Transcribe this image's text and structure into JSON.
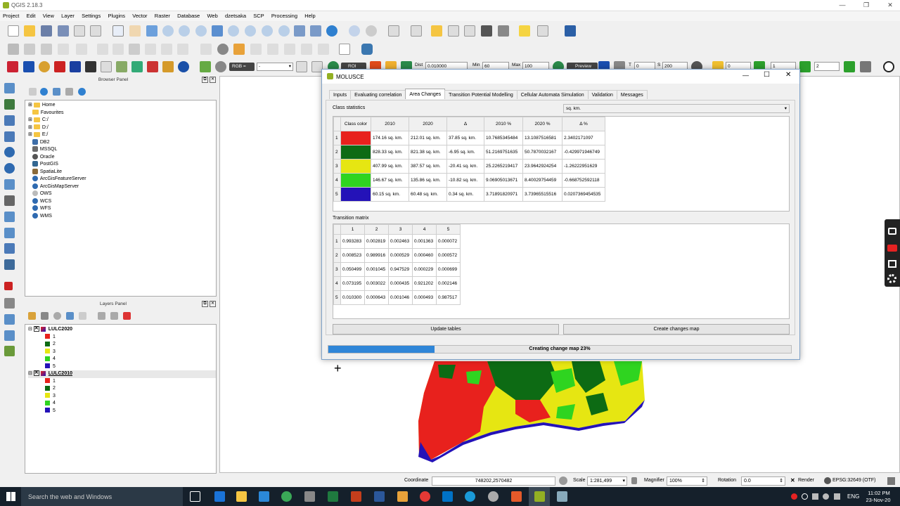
{
  "app": {
    "title": "QGIS 2.18.3"
  },
  "menu": [
    "Project",
    "Edit",
    "View",
    "Layer",
    "Settings",
    "Plugins",
    "Vector",
    "Raster",
    "Database",
    "Web",
    "dzetsaka",
    "SCP",
    "Processing",
    "Help"
  ],
  "toolbar3": {
    "rgb": "RGB =",
    "dist_label": "Dist",
    "dist_value": "0.010000",
    "min_label": "Min",
    "min_value": "60",
    "max_label": "Max",
    "max_value": "100",
    "roi_label": "ROI",
    "preview_label": "Preview",
    "t_label": "T",
    "t_value": "0",
    "s_label": "S",
    "s_value": "200",
    "val0": "0",
    "val1": "1",
    "val2": "2"
  },
  "browser": {
    "title": "Browser Panel",
    "items": [
      "Home",
      "Favourites",
      "C:/",
      "D:/",
      "E:/",
      "DB2",
      "MSSQL",
      "Oracle",
      "PostGIS",
      "SpatiaLite",
      "ArcGisFeatureServer",
      "ArcGisMapServer",
      "OWS",
      "WCS",
      "WFS",
      "WMS"
    ]
  },
  "layers": {
    "title": "Layers Panel",
    "groups": [
      {
        "name": "LULC2020",
        "classes": [
          "1",
          "2",
          "3",
          "4",
          "5"
        ]
      },
      {
        "name": "LULC2010",
        "classes": [
          "1",
          "2",
          "3",
          "4",
          "5"
        ]
      }
    ]
  },
  "dialog": {
    "title": "MOLUSCE",
    "tabs": [
      "Inputs",
      "Evaluating correlation",
      "Area Changes",
      "Transition Potential Modelling",
      "Cellular Automata Simulation",
      "Validation",
      "Messages"
    ],
    "class_stats_label": "Class statistics",
    "unit_select": "sq. km.",
    "stats_headers": [
      "Class color",
      "2010",
      "2020",
      "Δ",
      "2010 %",
      "2020 %",
      "Δ %"
    ],
    "stats_rows": [
      {
        "id": "1",
        "color": "#e8211d",
        "v2010": "174.16 sq. km.",
        "v2020": "212.01 sq. km.",
        "delta": "37.85 sq. km.",
        "p2010": "10.7685345484",
        "p2020": "13.1087516581",
        "pdelta": "2.3402171097"
      },
      {
        "id": "2",
        "color": "#0d6b14",
        "v2010": "828.33 sq. km.",
        "v2020": "821.38 sq. km.",
        "delta": "-6.95 sq. km.",
        "p2010": "51.2169751635",
        "p2020": "50.7870032167",
        "pdelta": "-0.429971946749"
      },
      {
        "id": "3",
        "color": "#e6e612",
        "v2010": "407.99 sq. km.",
        "v2020": "387.57 sq. km.",
        "delta": "-20.41 sq. km.",
        "p2010": "25.2265219417",
        "p2020": "23.9642924254",
        "pdelta": "-1.26222951629"
      },
      {
        "id": "4",
        "color": "#2fd420",
        "v2010": "146.67 sq. km.",
        "v2020": "135.86 sq. km.",
        "delta": "-10.82 sq. km.",
        "p2010": "9.06905013671",
        "p2020": "8.40029754459",
        "pdelta": "-0.668752592118"
      },
      {
        "id": "5",
        "color": "#2412b8",
        "v2010": "60.15 sq. km.",
        "v2020": "60.48 sq. km.",
        "delta": "0.34 sq. km.",
        "p2010": "3.71891820971",
        "p2020": "3.73965515516",
        "pdelta": "0.0207369454535"
      }
    ],
    "matrix_label": "Transition matrix",
    "matrix_headers": [
      "1",
      "2",
      "3",
      "4",
      "5"
    ],
    "matrix_rows": [
      [
        "1",
        "0.993283",
        "0.002819",
        "0.002463",
        "0.001363",
        "0.000072"
      ],
      [
        "2",
        "0.008523",
        "0.989916",
        "0.000529",
        "0.000460",
        "0.000572"
      ],
      [
        "3",
        "0.050499",
        "0.001045",
        "0.947529",
        "0.000229",
        "0.000699"
      ],
      [
        "4",
        "0.073195",
        "0.003022",
        "0.000435",
        "0.921202",
        "0.002146"
      ],
      [
        "5",
        "0.010300",
        "0.000643",
        "0.001046",
        "0.000493",
        "0.987517"
      ]
    ],
    "update_button": "Update tables",
    "create_button": "Create changes map",
    "progress_text": "Creating change map 23%",
    "progress": 0.23
  },
  "statusbar": {
    "coord_label": "Coordinate",
    "coord_value": "748202,2570482",
    "scale_label": "Scale",
    "scale_value": "1:281,499",
    "mag_label": "Magnifier",
    "mag_value": "100%",
    "rot_label": "Rotation",
    "rot_value": "0.0",
    "render_label": "Render",
    "crs": "EPSG:32649 (OTF)"
  },
  "taskbar": {
    "search_placeholder": "Search the web and Windows",
    "lang": "ENG",
    "time": "11:02 PM",
    "date": "23-Nov-20"
  }
}
